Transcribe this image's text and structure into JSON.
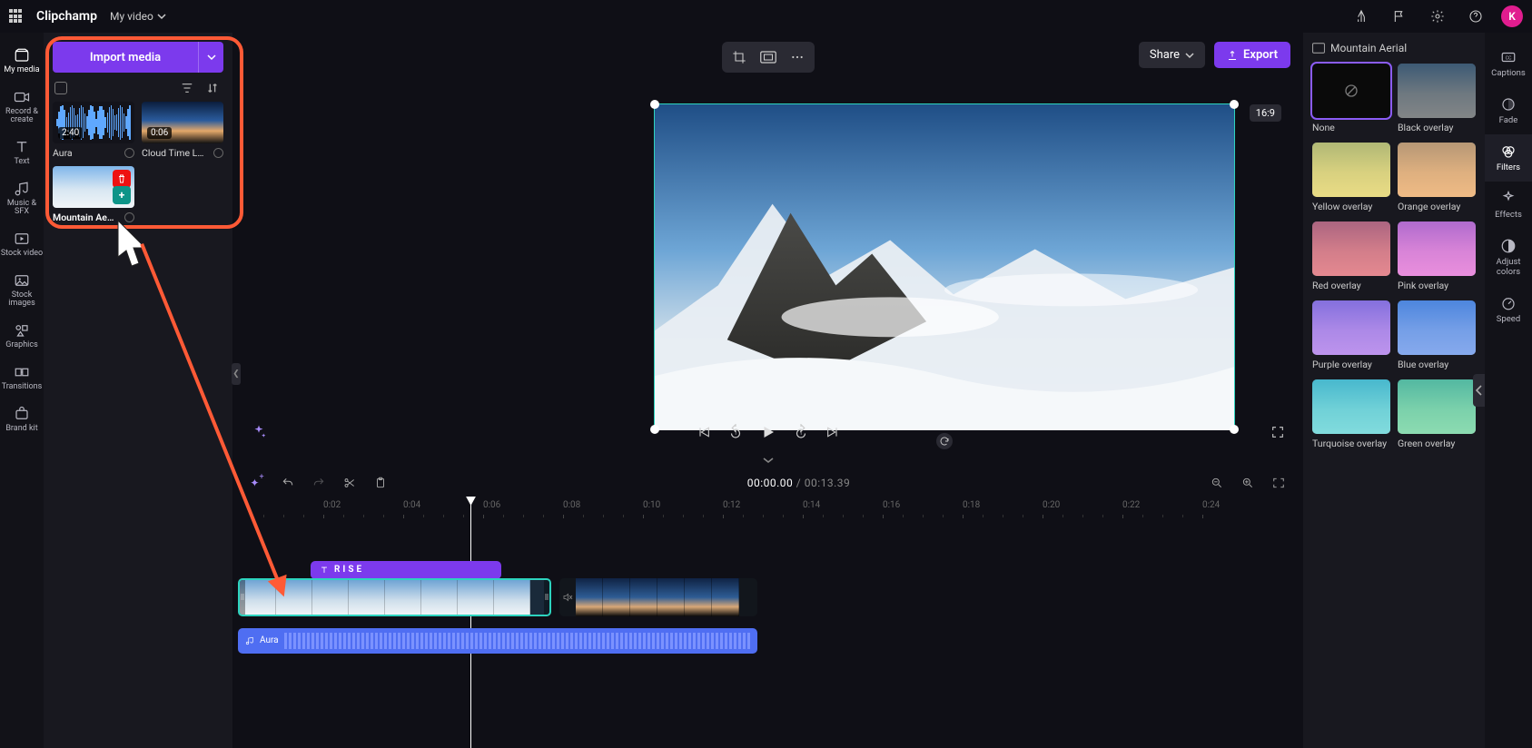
{
  "app": {
    "brand": "Clipchamp",
    "doc_title": "My video",
    "avatar_initial": "K"
  },
  "left_nav": [
    {
      "id": "my-media",
      "label": "My media"
    },
    {
      "id": "record-create",
      "label": "Record & create"
    },
    {
      "id": "text",
      "label": "Text"
    },
    {
      "id": "music-sfx",
      "label": "Music & SFX"
    },
    {
      "id": "stock-video",
      "label": "Stock video"
    },
    {
      "id": "stock-images",
      "label": "Stock images"
    },
    {
      "id": "graphics",
      "label": "Graphics"
    },
    {
      "id": "transitions",
      "label": "Transitions"
    },
    {
      "id": "brand-kit",
      "label": "Brand kit"
    }
  ],
  "media_panel": {
    "import_label": "Import media",
    "items": [
      {
        "name": "Aura",
        "duration": "2:40",
        "kind": "audio"
      },
      {
        "name": "Cloud Time L…",
        "duration": "0:06",
        "kind": "video-sunset"
      },
      {
        "name": "Mountain Ae…",
        "duration": "",
        "kind": "video-mountain",
        "selected": true
      }
    ],
    "tooltip": "Add to timeline"
  },
  "stage": {
    "share_label": "Share",
    "export_label": "Export",
    "ratio_label": "16:9"
  },
  "timeline": {
    "current": "00:00.00",
    "total": "00:13.39",
    "ticks": [
      "0:02",
      "0:04",
      "0:06",
      "0:08",
      "0:10",
      "0:12",
      "0:14",
      "0:16",
      "0:18",
      "0:20",
      "0:22",
      "0:24"
    ],
    "text_clip_label": "RISE",
    "audio_clip_label": "Aura"
  },
  "right_panel": {
    "title": "Mountain Aerial",
    "filters": [
      {
        "label": "None",
        "overlay": "none",
        "selected": true
      },
      {
        "label": "Black overlay",
        "overlay": "rgba(0,0,0,.45)"
      },
      {
        "label": "Yellow overlay",
        "overlay": "rgba(230,200,40,.55)"
      },
      {
        "label": "Orange overlay",
        "overlay": "rgba(240,140,40,.55)"
      },
      {
        "label": "Red overlay",
        "overlay": "rgba(220,50,60,.55)"
      },
      {
        "label": "Pink overlay",
        "overlay": "rgba(230,60,200,.55)"
      },
      {
        "label": "Purple overlay",
        "overlay": "rgba(150,70,230,.55)"
      },
      {
        "label": "Blue overlay",
        "overlay": "rgba(50,110,230,.55)"
      },
      {
        "label": "Turquoise overlay",
        "overlay": "rgba(40,200,200,.55)"
      },
      {
        "label": "Green overlay",
        "overlay": "rgba(60,200,120,.55)"
      }
    ]
  },
  "right_rail": [
    {
      "id": "captions",
      "label": "Captions"
    },
    {
      "id": "fade",
      "label": "Fade"
    },
    {
      "id": "filters",
      "label": "Filters",
      "active": true
    },
    {
      "id": "effects",
      "label": "Effects"
    },
    {
      "id": "adjust",
      "label": "Adjust colors"
    },
    {
      "id": "speed",
      "label": "Speed"
    }
  ]
}
